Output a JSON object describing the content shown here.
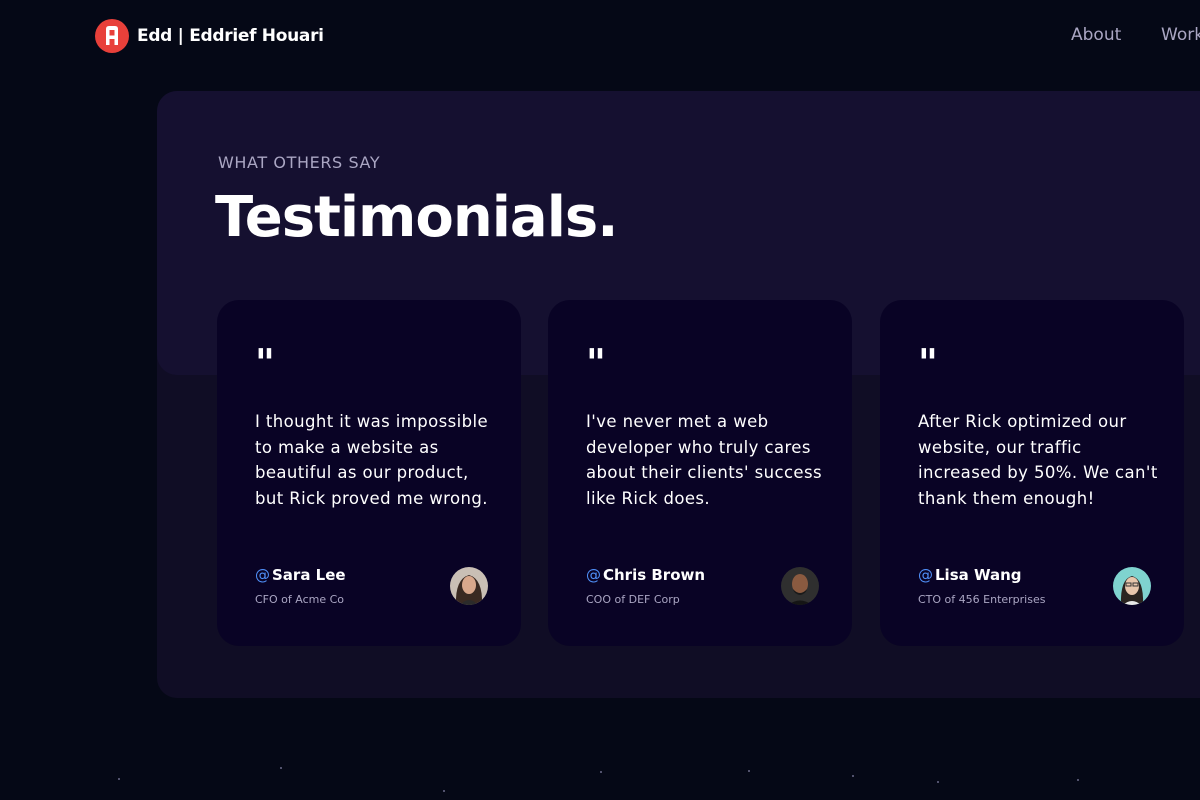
{
  "nav": {
    "logo_icon": "monogram-logo",
    "brand": "Edd  | Eddrief Houari",
    "links": [
      "About",
      "Work"
    ]
  },
  "section": {
    "subtitle": "WHAT OTHERS SAY",
    "title": "Testimonials."
  },
  "testimonials": [
    {
      "quote_icon": "quote-icon",
      "text": "I thought it was impossible to make a website as beautiful as our product, but Rick proved me wrong.",
      "at": "@",
      "name": "Sara Lee",
      "title": "CFO of Acme Co",
      "avatar": "woman-avatar"
    },
    {
      "quote_icon": "quote-icon",
      "text": "I've never met a web developer who truly cares about their clients' success like Rick does.",
      "at": "@",
      "name": "Chris Brown",
      "title": "COO of DEF Corp",
      "avatar": "man-avatar"
    },
    {
      "quote_icon": "quote-icon",
      "text": "After Rick optimized our website, our traffic increased by 50%. We can't thank them enough!",
      "at": "@",
      "name": "Lisa Wang",
      "title": "CTO of 456 Enterprises",
      "avatar": "woman-avatar"
    }
  ],
  "colors": {
    "background": "#050816",
    "panel": "#100d25",
    "panel_top": "#151030",
    "card": "#090325",
    "secondary_text": "#aaa6c3",
    "accent_blue": "#4f8ff7",
    "logo_red": "#e8403a"
  }
}
